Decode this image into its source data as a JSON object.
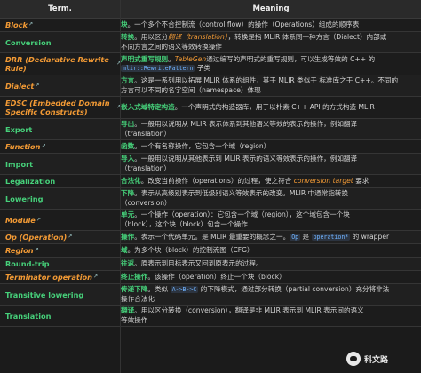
{
  "header": {
    "term": "Term.",
    "meaning": "Meaning"
  },
  "rows": [
    {
      "term": "Block",
      "style": "orange",
      "ext": true,
      "lines": [
        [
          {
            "t": "块",
            "c": "g"
          },
          {
            "t": "。一个多个不合控制流（control flow）的操作（Operations）组成的顺序表"
          }
        ]
      ]
    },
    {
      "term": "Conversion",
      "style": "green",
      "ext": false,
      "lines": [
        [
          {
            "t": "转换",
            "c": "g"
          },
          {
            "t": "。用以区分"
          },
          {
            "t": "翻译（translation）",
            "c": "o"
          },
          {
            "t": "，转换是指 MLIR 体系同一种方言（Dialect）内部或"
          }
        ],
        [
          {
            "t": "不同方言之间的语义等效转换操作"
          }
        ]
      ]
    },
    {
      "term": "DRR (Declarative Rewrite Rule)",
      "style": "orange",
      "ext": true,
      "lines": [
        [
          {
            "t": "声明式重写规则",
            "c": "g"
          },
          {
            "t": "。"
          },
          {
            "t": "TableGen",
            "c": "o"
          },
          {
            "t": "通过编写的声明式的重写规则，可以生成等效的 C++ 的"
          }
        ],
        [
          {
            "t": "mlir::RewritePattern",
            "c": "code"
          },
          {
            "t": " 子类"
          }
        ]
      ]
    },
    {
      "term": "Dialect",
      "style": "orange",
      "ext": true,
      "lines": [
        [
          {
            "t": "方言",
            "c": "g"
          },
          {
            "t": "。这是一系列用以拓展 MLIR 体系的组件，其于 MLIR 类似于 标准库之于 C++。不同的"
          }
        ],
        [
          {
            "t": "方言可以不同的名字空间（namespace）体现"
          }
        ]
      ]
    },
    {
      "term": "EDSC (Embedded Domain Specific Constructs)",
      "style": "orange",
      "ext": true,
      "lines": [
        [
          {
            "t": "嵌入式域特定构造",
            "c": "g"
          },
          {
            "t": "。一个声明式的构造器库，用于以朴素 C++ API 的方式构造 MLIR"
          }
        ]
      ]
    },
    {
      "term": "Export",
      "style": "green",
      "ext": false,
      "lines": [
        [
          {
            "t": "导出",
            "c": "g"
          },
          {
            "t": "。一般用以说明从 MLIR 表示体系到其他语义等效的表示的操作，例如翻译"
          }
        ],
        [
          {
            "t": "（translation）"
          }
        ]
      ]
    },
    {
      "term": "Function",
      "style": "orange",
      "ext": true,
      "lines": [
        [
          {
            "t": "函数",
            "c": "g"
          },
          {
            "t": "。一个有名称操作，它包含一个域（region）"
          }
        ]
      ]
    },
    {
      "term": "Import",
      "style": "green",
      "ext": false,
      "lines": [
        [
          {
            "t": "导入",
            "c": "g"
          },
          {
            "t": "。一般用以说明从其他表示到 MLIR 表示的语义等效表示的操作，例如翻译"
          }
        ],
        [
          {
            "t": "（translation）"
          }
        ]
      ]
    },
    {
      "term": "Legalization",
      "style": "green",
      "ext": false,
      "lines": [
        [
          {
            "t": "合法化",
            "c": "g"
          },
          {
            "t": "。改变当前操作（operations）的过程，使之符合 "
          },
          {
            "t": "conversion target",
            "c": "o"
          },
          {
            "t": " 要求"
          }
        ]
      ]
    },
    {
      "term": "Lowering",
      "style": "green",
      "ext": false,
      "lines": [
        [
          {
            "t": "下降",
            "c": "g"
          },
          {
            "t": "。表示从高级别表示到低级别语义等效表示的改变。MLIR 中通常指转换"
          }
        ],
        [
          {
            "t": "（conversion）"
          }
        ]
      ]
    },
    {
      "term": "Module",
      "style": "orange",
      "ext": true,
      "lines": [
        [
          {
            "t": "单元",
            "c": "g"
          },
          {
            "t": "。一个操作（operation）：它包含一个域（region），这个域包含一个块"
          }
        ],
        [
          {
            "t": "（block），这个块（block）包含一个操作"
          }
        ]
      ]
    },
    {
      "term": "Op (Operation)",
      "style": "orange",
      "ext": true,
      "lines": [
        [
          {
            "t": "操作",
            "c": "g"
          },
          {
            "t": "。表示一个代码单元。是 MLIR 最重要的概念之一。"
          },
          {
            "t": "Op",
            "c": "code"
          },
          {
            "t": " 是 "
          },
          {
            "t": "operation*",
            "c": "code"
          },
          {
            "t": " 的 wrapper"
          }
        ]
      ]
    },
    {
      "term": "Region",
      "style": "orange",
      "ext": true,
      "lines": [
        [
          {
            "t": "域",
            "c": "g"
          },
          {
            "t": "。为多个块（block）的控制流图（CFG）"
          }
        ]
      ]
    },
    {
      "term": "Round-trip",
      "style": "green",
      "ext": false,
      "lines": [
        [
          {
            "t": "往返",
            "c": "g"
          },
          {
            "t": "。原表示到目标表示又回到原表示的过程。"
          }
        ]
      ]
    },
    {
      "term": "Terminator operation",
      "style": "orange",
      "ext": true,
      "lines": [
        [
          {
            "t": "终止操作",
            "c": "g"
          },
          {
            "t": "。该操作（operation）终止一个块（block）"
          }
        ]
      ]
    },
    {
      "term": "Transitive lowering",
      "style": "green",
      "ext": false,
      "lines": [
        [
          {
            "t": "传递下降",
            "c": "g"
          },
          {
            "t": "。类似 "
          },
          {
            "t": "A->B->C",
            "c": "code"
          },
          {
            "t": " 的下降模式，通过部分转换（partial conversion）充分将非法"
          }
        ],
        [
          {
            "t": "操作合法化"
          }
        ]
      ]
    },
    {
      "term": "Translation",
      "style": "green",
      "ext": false,
      "lines": [
        [
          {
            "t": "翻译",
            "c": "g"
          },
          {
            "t": "。用以区分转换（conversion），翻译是非 MLIR 表示到 MLIR 表示间的语义"
          }
        ],
        [
          {
            "t": "等效操作"
          }
        ]
      ]
    }
  ],
  "watermark": {
    "text": "科文路"
  }
}
